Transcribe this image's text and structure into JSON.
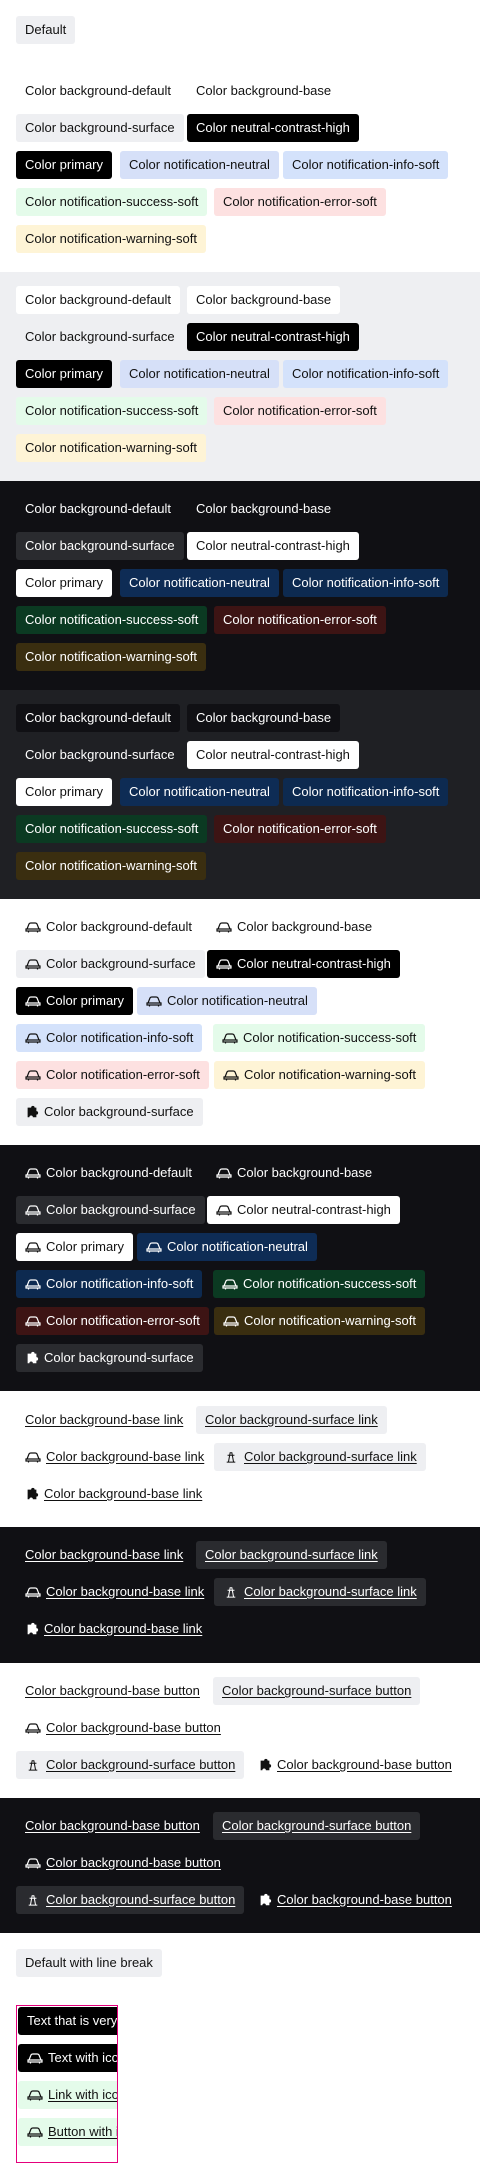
{
  "top": {
    "default_label": "Default"
  },
  "labels": {
    "bg_default": "Color background-default",
    "bg_base": "Color background-base",
    "bg_surface": "Color background-surface",
    "neutral_contrast_high": "Color neutral-contrast-high",
    "primary": "Color primary",
    "notif_neutral": "Color notification-neutral",
    "notif_info": "Color notification-info-soft",
    "notif_success": "Color notification-success-soft",
    "notif_error": "Color notification-error-soft",
    "notif_warning": "Color notification-warning-soft"
  },
  "links": {
    "base_link": "Color background-base link",
    "surface_link": "Color background-surface link",
    "base_button": "Color background-base button",
    "surface_button": "Color background-surface button"
  },
  "linebreak": {
    "label": "Default with line break",
    "text_long": "Text that is very long and wraps",
    "text_icon": "Text with icon",
    "link_icon": "Link with icon",
    "button_icon": "Button with icon"
  },
  "icons": {
    "car": "car-icon",
    "tollgate": "tollgate-icon",
    "puzzle": "puzzle-icon"
  },
  "colors": {
    "light_surface": "#eeeff2",
    "dark_bg": "#101014",
    "dark_bg_alt": "#1f2024",
    "accent_pink": "#e4007c"
  }
}
